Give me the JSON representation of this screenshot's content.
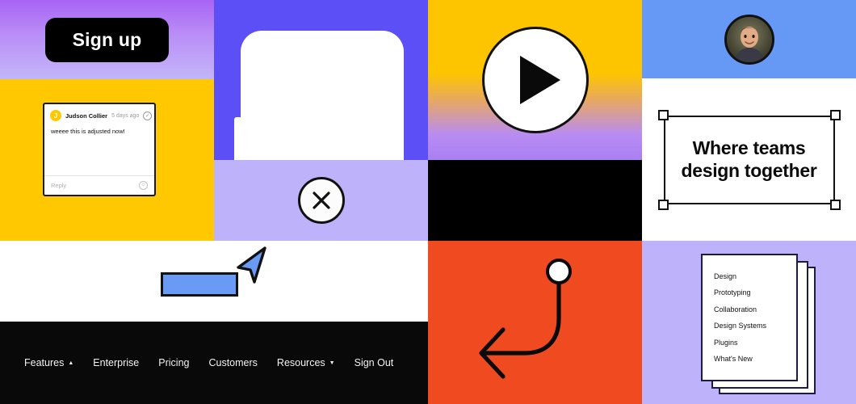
{
  "panels": {
    "signup": {
      "button_label": "Sign up",
      "bg_top": "#a863f5",
      "bg_bottom": "#c3b6f8"
    },
    "comment": {
      "bg": "#ffc800",
      "avatar_initial": "J",
      "author": "Judson Collier",
      "timestamp": "5 days ago",
      "message": "weeee this is adjusted now!",
      "reply_placeholder": "Reply",
      "resolve_icon": "check-circle-icon",
      "emoji_icon": "emoji-icon",
      "pin_icon": "comment-pin-icon"
    },
    "cursor": {
      "bg": "#ffffff",
      "rect_fill": "#6a9bf4",
      "rect_stroke": "#121212",
      "cursor_icon": "cursor-arrow-icon"
    },
    "nav": {
      "bg": "#090909",
      "items": [
        {
          "label": "Features",
          "caret": "▲"
        },
        {
          "label": "Enterprise",
          "caret": ""
        },
        {
          "label": "Pricing",
          "caret": ""
        },
        {
          "label": "Customers",
          "caret": ""
        },
        {
          "label": "Resources",
          "caret": "▼"
        },
        {
          "label": "Sign Out",
          "caret": ""
        }
      ]
    },
    "device": {
      "bg": "#5b4ff5",
      "screen": "#ffffff",
      "icon": "phone-mockup-icon"
    },
    "close": {
      "bg": "#beb2fb",
      "icon": "close-icon",
      "glyph": "✕"
    },
    "play": {
      "bg_top": "#fdc500",
      "bg_bottom": "#a97ff2",
      "icon": "play-icon"
    },
    "black": {
      "bg": "#000000"
    },
    "arrow": {
      "bg": "#f04a20",
      "icon": "curved-arrow-icon",
      "stroke": "#0a0a0a"
    },
    "avatar": {
      "bg": "#6699f5",
      "icon": "user-avatar"
    },
    "tagline": {
      "bg": "#ffffff",
      "line1": "Where teams",
      "line2": "design together",
      "handles": 4
    },
    "menu": {
      "bg": "#beb2fb",
      "sheets": 3,
      "items": [
        "Design",
        "Prototyping",
        "Collaboration",
        "Design Systems",
        "Plugins",
        "What's New"
      ]
    }
  }
}
